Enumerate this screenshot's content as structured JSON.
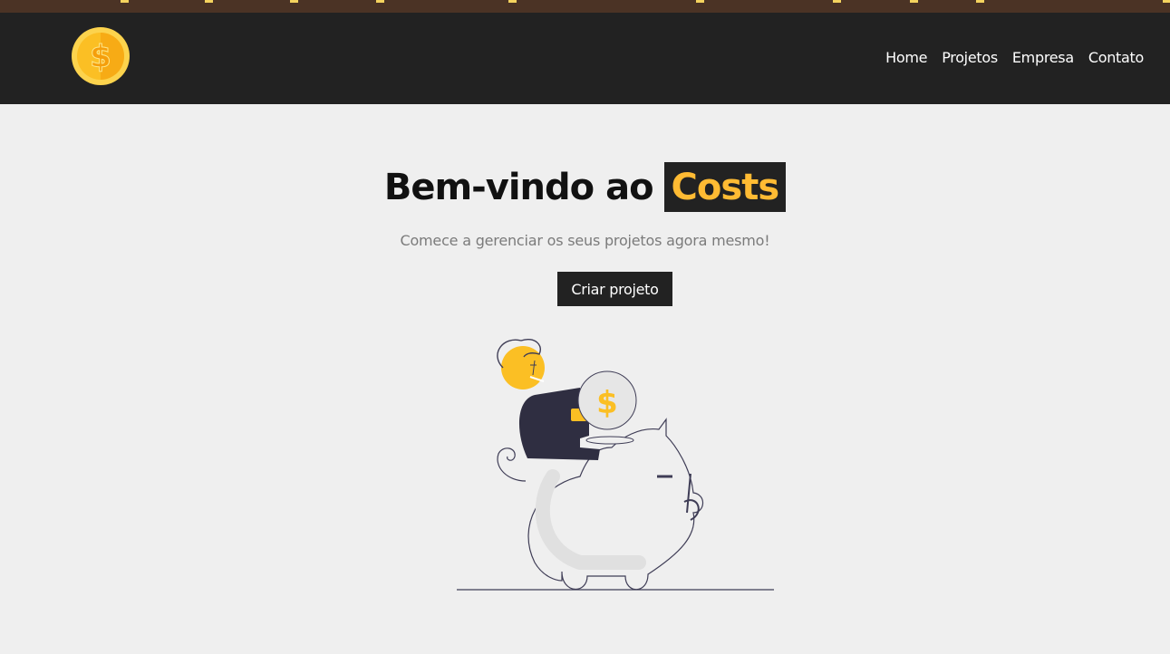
{
  "nav": {
    "links": [
      {
        "label": "Home"
      },
      {
        "label": "Projetos"
      },
      {
        "label": "Empresa"
      },
      {
        "label": "Contato"
      }
    ]
  },
  "hero": {
    "title_prefix": "Bem-vindo ao",
    "title_brand": "Costs",
    "subtitle": "Comece a gerenciar os seus projetos agora mesmo!",
    "cta_label": "Criar projeto"
  },
  "icons": {
    "logo": "coin-dollar-icon",
    "illustration": "piggy-bank-savings-illustration"
  },
  "colors": {
    "navbar_bg": "#222222",
    "accent": "#ffbb33",
    "page_bg": "#efefef",
    "bookmark_strip": "#4b3325"
  }
}
